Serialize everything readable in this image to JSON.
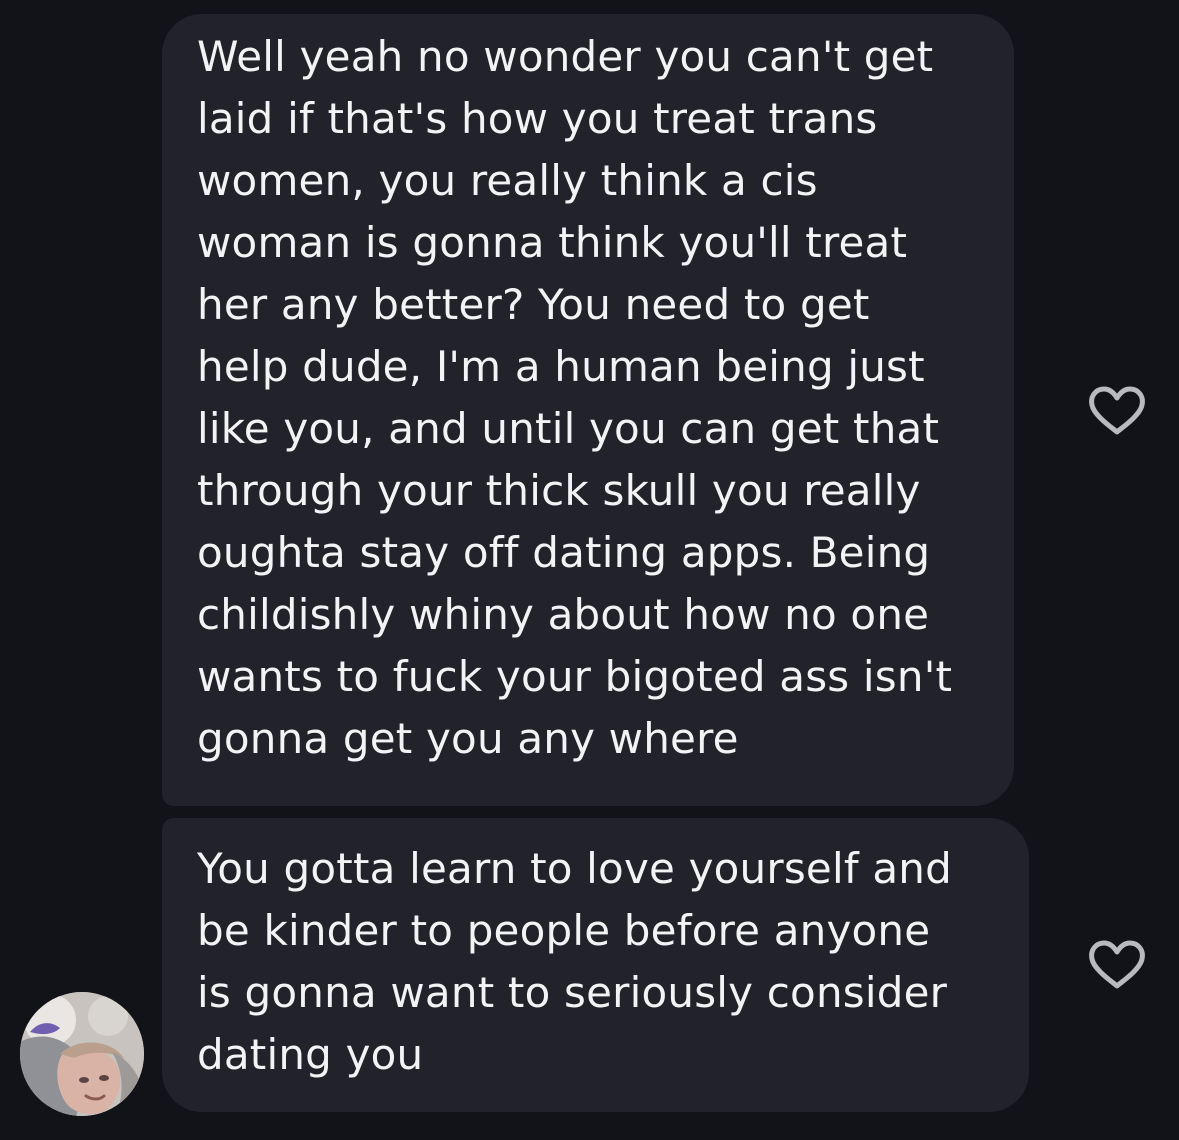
{
  "messages": [
    {
      "text": "Well yeah no wonder you can't get\nlaid if that's how you treat trans\nwomen, you really think a cis\nwoman is gonna think you'll treat\nher any better? You need to get\nhelp dude, I'm a human being just\nlike you, and until you can get that\nthrough your thick skull you really\noughta stay off dating apps. Being\nchildishly whiny about how no one\nwants to fuck your bigoted ass isn't\ngonna get you any where",
      "like_icon": "heart-outline-icon"
    },
    {
      "text": "You gotta learn to love yourself and\nbe kinder to people before anyone\nis gonna want to seriously consider\ndating you",
      "like_icon": "heart-outline-icon"
    }
  ],
  "sender": {
    "avatar_icon": "profile-photo"
  },
  "colors": {
    "background": "#121318",
    "bubble": "#22232a",
    "text": "#f3f3f5",
    "icon": "#b9bac0"
  }
}
